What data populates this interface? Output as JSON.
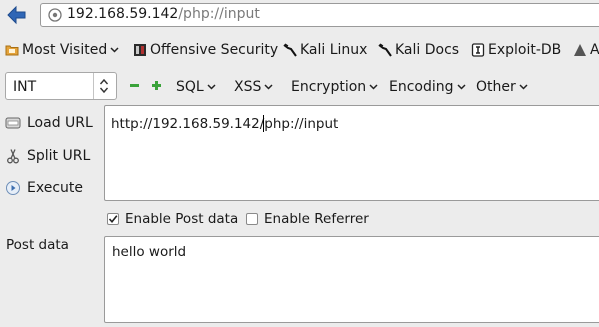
{
  "address_bar": {
    "host": "192.168.59.142",
    "path": "/php://input"
  },
  "bookmarks": [
    {
      "label": "Most Visited",
      "icon": "folder-icon",
      "has_dropdown": true
    },
    {
      "label": "Offensive Security",
      "icon": "offensive-security-icon",
      "has_dropdown": false
    },
    {
      "label": "Kali Linux",
      "icon": "kali-dragon-icon",
      "has_dropdown": false
    },
    {
      "label": "Kali Docs",
      "icon": "kali-dragon-icon",
      "has_dropdown": false
    },
    {
      "label": "Exploit-DB",
      "icon": "exploit-db-icon",
      "has_dropdown": false
    },
    {
      "label": "A",
      "icon": "aircrack-icon",
      "has_dropdown": false
    }
  ],
  "hackbar": {
    "type_select": "INT",
    "menus": [
      "SQL",
      "XSS",
      "Encryption",
      "Encoding",
      "Other"
    ],
    "actions": [
      {
        "label": "Load URL",
        "icon": "load-url-icon"
      },
      {
        "label": "Split URL",
        "icon": "scissors-icon"
      },
      {
        "label": "Execute",
        "icon": "execute-icon"
      }
    ],
    "url_value": "http://192.168.59.142/php://input",
    "enable_post_label": "Enable Post data",
    "enable_post_checked": true,
    "enable_referrer_label": "Enable Referrer",
    "enable_referrer_checked": false,
    "post_data_label": "Post data",
    "post_data_value": "hello world"
  },
  "colors": {
    "toolbar_bg": "#ececec",
    "back_arrow": "#2f66b6",
    "plus_minus_green": "#3aa33a"
  }
}
